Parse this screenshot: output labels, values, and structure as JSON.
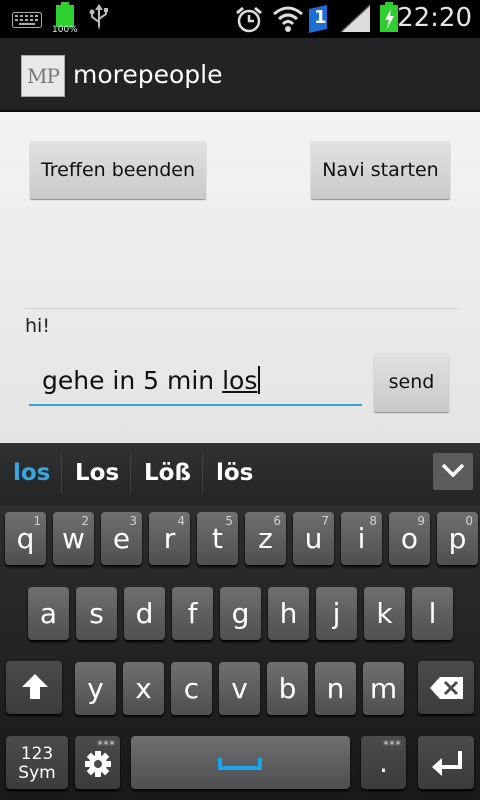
{
  "status_bar": {
    "battery_percent": "100%",
    "notification_badge": "1",
    "time": "22:20",
    "icons": [
      "keyboard-icon",
      "battery-icon",
      "usb-icon",
      "alarm-icon",
      "wifi-icon",
      "notification-badge-icon",
      "signal-icon",
      "battery-charging-icon"
    ]
  },
  "action_bar": {
    "logo_text": "MP",
    "title": "morepeople"
  },
  "main": {
    "end_meeting_label": "Treffen beenden",
    "start_navi_label": "Navi starten",
    "message": "hi!",
    "input_value": "gehe in 5 min ",
    "input_composing": "los",
    "send_label": "send"
  },
  "suggestions": [
    "los",
    "Los",
    "Löß",
    "lös"
  ],
  "keyboard": {
    "row1": [
      {
        "c": "q",
        "h": "1"
      },
      {
        "c": "w",
        "h": "2"
      },
      {
        "c": "e",
        "h": "3"
      },
      {
        "c": "r",
        "h": "4"
      },
      {
        "c": "t",
        "h": "5"
      },
      {
        "c": "z",
        "h": "6"
      },
      {
        "c": "u",
        "h": "7"
      },
      {
        "c": "i",
        "h": "8"
      },
      {
        "c": "o",
        "h": "9"
      },
      {
        "c": "p",
        "h": "0"
      }
    ],
    "row2": [
      "a",
      "s",
      "d",
      "f",
      "g",
      "h",
      "j",
      "k",
      "l"
    ],
    "row3": [
      "y",
      "x",
      "c",
      "v",
      "b",
      "n",
      "m"
    ],
    "sym_label_1": "123",
    "sym_label_2": "Sym",
    "period": ".",
    "more_hint": "***"
  },
  "colors": {
    "accent": "#33a7d8",
    "suggestion_primary": "#3aa6e0",
    "battery_green": "#2fcf2f"
  }
}
